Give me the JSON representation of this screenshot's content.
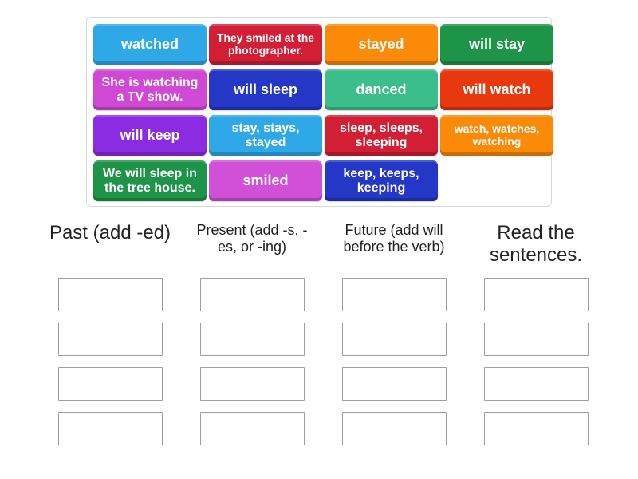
{
  "activity": {
    "type": "group-sort",
    "tile_bank": {
      "rows": 4,
      "columns": 4,
      "tiles": [
        {
          "label": "watched",
          "color": "#2FA8E8",
          "size": "lg"
        },
        {
          "label": "They smiled at the photographer.",
          "color": "#D31F36",
          "size": "sm"
        },
        {
          "label": "stayed",
          "color": "#FB8A08",
          "size": "lg"
        },
        {
          "label": "will stay",
          "color": "#1E9448",
          "size": "lg"
        },
        {
          "label": "She is watching a TV show.",
          "color": "#CF49D4",
          "size": "md"
        },
        {
          "label": "will sleep",
          "color": "#2437C6",
          "size": "lg"
        },
        {
          "label": "danced",
          "color": "#3BBE8B",
          "size": "lg"
        },
        {
          "label": "will watch",
          "color": "#E8380D",
          "size": "lg"
        },
        {
          "label": "will keep",
          "color": "#8B2BE2",
          "size": "lg"
        },
        {
          "label": "stay, stays, stayed",
          "color": "#2FA8E8",
          "size": "md"
        },
        {
          "label": "sleep, sleeps, sleeping",
          "color": "#D31F36",
          "size": "md"
        },
        {
          "label": "watch, watches, watching",
          "color": "#FB8A08",
          "size": "sm"
        },
        {
          "label": "We will sleep in the tree house.",
          "color": "#1E9448",
          "size": "md"
        },
        {
          "label": "smiled",
          "color": "#D050D8",
          "size": "lg"
        },
        {
          "label": "keep, keeps, keeping",
          "color": "#2437C6",
          "size": "md"
        },
        {
          "label": "",
          "color": "transparent",
          "size": "lg",
          "empty": true
        }
      ]
    },
    "columns": [
      {
        "title": "Past (add -ed)",
        "title_size": "lg",
        "slots": 4
      },
      {
        "title": "Present (add -s, -es, or -ing)",
        "title_size": "md",
        "slots": 4
      },
      {
        "title": "Future (add will before the verb)",
        "title_size": "md",
        "slots": 4
      },
      {
        "title": "Read the sentences.",
        "title_size": "lg",
        "slots": 4
      }
    ]
  }
}
